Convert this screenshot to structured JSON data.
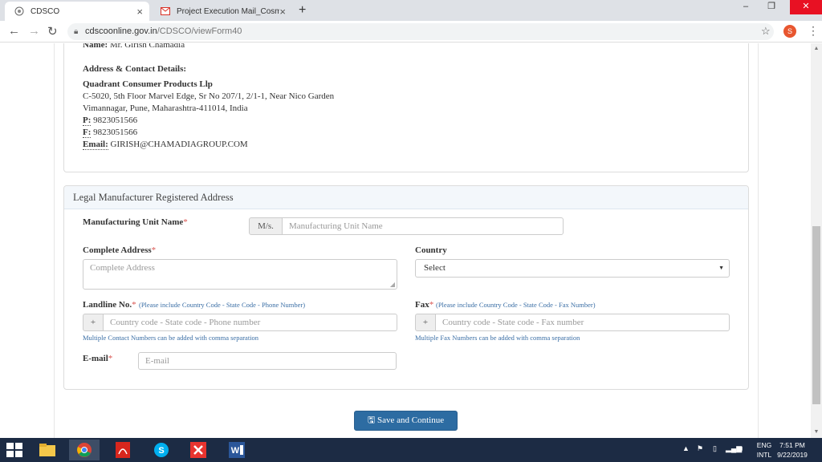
{
  "browser": {
    "tabs": [
      {
        "title": "CDSCO",
        "active": true
      },
      {
        "title": "Project Execution Mail_Cosmetic",
        "active": false
      }
    ],
    "url_host": "cdscoonline.gov.in",
    "url_path": "/CDSCO/viewForm40",
    "profile_initial": "S"
  },
  "contact": {
    "name_label": "Name:",
    "name_value": "Mr. Girish Chamadia",
    "section_title": "Address & Contact Details:",
    "company": "Quadrant Consumer Products Llp",
    "address_line1": "C-5020, 5th Floor Marvel Edge, Sr No 207/1, 2/1-1, Near Nico Garden",
    "address_line2": "Vimannagar, Pune, Maharashtra-411014, India",
    "phone_label": "P:",
    "phone_value": "9823051566",
    "fax_label": "F:",
    "fax_value": "9823051566",
    "email_label": "Email:",
    "email_value": "GIRISH@CHAMADIAGROUP.COM"
  },
  "legal": {
    "panel_title": "Legal Manufacturer Registered Address",
    "unit_label": "Manufacturing Unit Name",
    "unit_prefix": "M/s.",
    "unit_placeholder": "Manufacturing Unit Name",
    "address_label": "Complete Address",
    "address_placeholder": "Complete Address",
    "country_label": "Country",
    "country_selected": "Select",
    "landline_label": "Landline No.",
    "landline_hint": "(Please include Country Code - State Code - Phone Number)",
    "landline_placeholder": "Country code    -    State code    -    Phone number",
    "landline_note": "Multiple Contact Numbers can be added with comma separation",
    "fax_label": "Fax",
    "fax_hint": "(Please include Country Code - State Code - Fax Number)",
    "fax_placeholder": "Country code    -    State code    -    Fax number",
    "fax_note": "Multiple Fax Numbers can be added with comma separation",
    "email_label": "E-mail",
    "email_placeholder": "E-mail",
    "required_mark": "*",
    "plus_addon": "+"
  },
  "actions": {
    "save_label": "Save and Continue"
  },
  "taskbar": {
    "lang_top": "ENG",
    "lang_bottom": "INTL",
    "time": "7:51 PM",
    "date": "9/22/2019"
  },
  "colors": {
    "primary_button": "#2d6ca2",
    "panel_header": "#f3f7fb",
    "required": "#d9534f",
    "hint": "#3a6ea5"
  }
}
